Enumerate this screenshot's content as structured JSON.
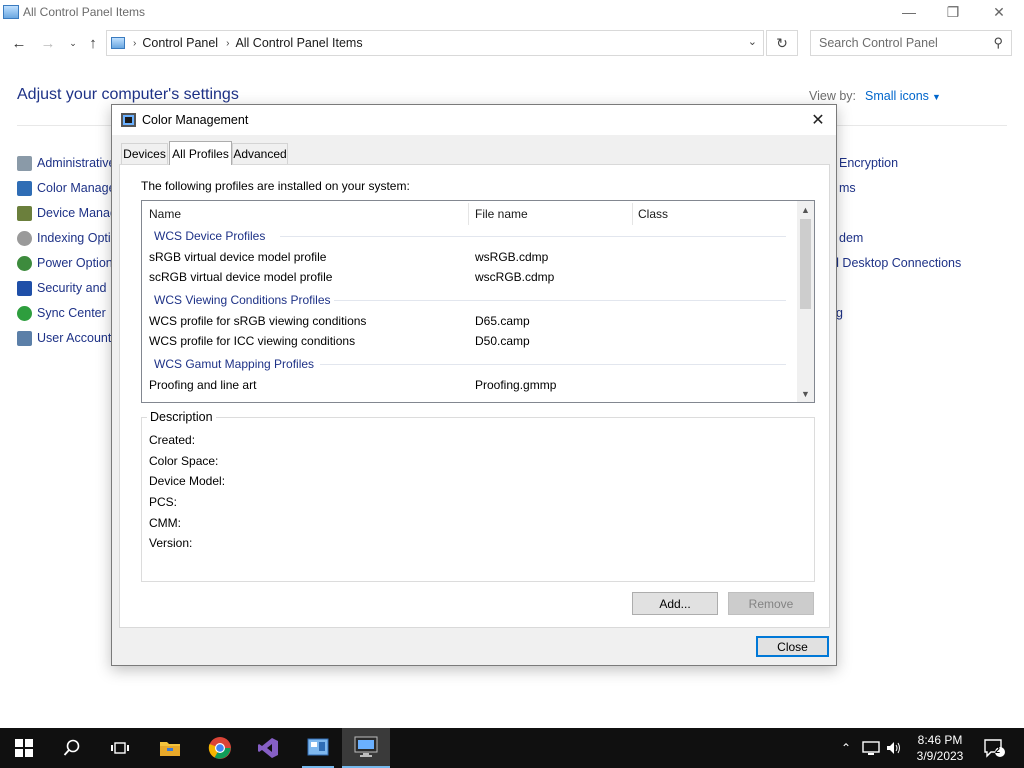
{
  "window": {
    "title": "All Control Panel Items"
  },
  "nav": {
    "breadcrumb": [
      "Control Panel",
      "All Control Panel Items"
    ],
    "search_placeholder": "Search Control Panel"
  },
  "content": {
    "heading": "Adjust your computer's settings",
    "view_by_label": "View by:",
    "view_by_value": "Small icons",
    "left_items": [
      "Administrative",
      "Color Manage",
      "Device Manag",
      "Indexing Optic",
      "Power Option",
      "Security and N",
      "Sync Center",
      "User Accounts"
    ],
    "right_items": [
      "Encryption",
      "ms",
      "",
      "dem",
      "d Desktop Connections",
      "",
      "g",
      ""
    ]
  },
  "dialog": {
    "title": "Color Management",
    "tabs": [
      "Devices",
      "All Profiles",
      "Advanced"
    ],
    "intro": "The following profiles are installed on your system:",
    "columns": [
      "Name",
      "File name",
      "Class"
    ],
    "groups": [
      {
        "name": "WCS Device Profiles",
        "rows": [
          {
            "name": "sRGB virtual device model profile",
            "file": "wsRGB.cdmp",
            "class": ""
          },
          {
            "name": "scRGB virtual device model profile",
            "file": "wscRGB.cdmp",
            "class": ""
          }
        ]
      },
      {
        "name": "WCS Viewing Conditions Profiles",
        "rows": [
          {
            "name": "WCS profile for sRGB viewing conditions",
            "file": "D65.camp",
            "class": ""
          },
          {
            "name": "WCS profile for ICC viewing conditions",
            "file": "D50.camp",
            "class": ""
          }
        ]
      },
      {
        "name": "WCS Gamut Mapping Profiles",
        "rows": [
          {
            "name": "Proofing and line art",
            "file": "Proofing.gmmp",
            "class": ""
          }
        ]
      }
    ],
    "description": {
      "legend": "Description",
      "fields": [
        "Created:",
        "Color Space:",
        "Device Model:",
        "PCS:",
        "CMM:",
        "Version:"
      ]
    },
    "buttons": {
      "add": "Add...",
      "remove": "Remove",
      "close": "Close"
    }
  },
  "taskbar": {
    "time": "8:46 PM",
    "date": "3/9/2023",
    "notifications": "2"
  }
}
